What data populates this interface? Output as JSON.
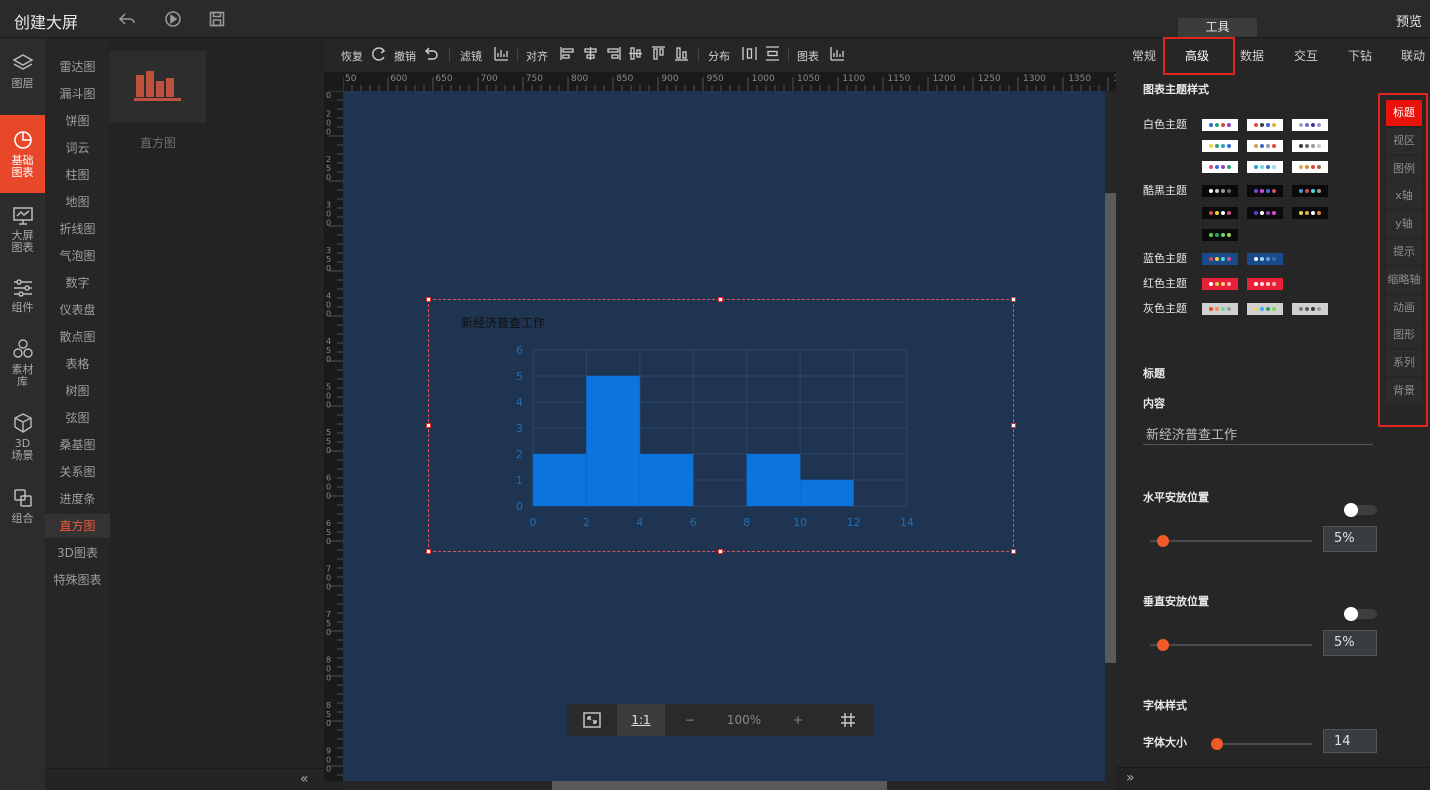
{
  "app": {
    "title": "创建大屏",
    "preview": "预览"
  },
  "tool_tab": "工具",
  "leftnav": [
    {
      "label": "图层",
      "icon": "layers-icon"
    },
    {
      "label": "基础图表",
      "icon": "pie-chart-icon",
      "active": true
    },
    {
      "label": "大屏图表",
      "icon": "monitor-chart-icon"
    },
    {
      "label": "组件",
      "icon": "sliders-icon"
    },
    {
      "label": "素材库",
      "icon": "hexagons-icon"
    },
    {
      "label": "3D场景",
      "icon": "cube-icon"
    },
    {
      "label": "组合",
      "icon": "combine-icon"
    }
  ],
  "chart_types": [
    "雷达图",
    "漏斗图",
    "饼图",
    "词云",
    "柱图",
    "地图",
    "折线图",
    "气泡图",
    "数字",
    "仪表盘",
    "散点图",
    "表格",
    "树图",
    "弦图",
    "桑基图",
    "关系图",
    "进度条",
    "直方图",
    "3D图表",
    "特殊图表"
  ],
  "chart_types_active": "直方图",
  "thumbnail": {
    "label": "直方图",
    "icon": "histogram-icon",
    "color": "#c1513f"
  },
  "toolbar": {
    "redo": "恢复",
    "undo": "撤销",
    "filter": "滤镜",
    "align": "对齐",
    "distribute": "分布",
    "chart": "图表"
  },
  "ruler": {
    "h_ticks": [
      "50",
      "600",
      "650",
      "700",
      "750",
      "800",
      "850",
      "900",
      "950",
      "1000",
      "1050",
      "1100",
      "1150",
      "1200",
      "1250",
      "1300",
      "1350",
      "140"
    ],
    "v_ticks": [
      "0",
      "200",
      "250",
      "300",
      "350",
      "400",
      "450",
      "500",
      "550",
      "600",
      "650",
      "700",
      "750",
      "800",
      "850",
      "900"
    ]
  },
  "chart_data": {
    "type": "bar",
    "subtype": "histogram",
    "title": "新经济普查工作",
    "bins": [
      {
        "x0": 0,
        "x1": 2,
        "value": 2
      },
      {
        "x0": 2,
        "x1": 4,
        "value": 5
      },
      {
        "x0": 4,
        "x1": 6,
        "value": 2
      },
      {
        "x0": 6,
        "x1": 8,
        "value": 0
      },
      {
        "x0": 8,
        "x1": 10,
        "value": 2
      },
      {
        "x0": 10,
        "x1": 12,
        "value": 1
      },
      {
        "x0": 12,
        "x1": 14,
        "value": 0
      }
    ],
    "xlim": [
      0,
      14
    ],
    "ylim": [
      0,
      6
    ],
    "x_ticks": [
      0,
      2,
      4,
      6,
      8,
      10,
      12,
      14
    ],
    "y_ticks": [
      0,
      1,
      2,
      3,
      4,
      5,
      6
    ],
    "grid": true,
    "bar_color": "#0b74de",
    "axis_label_color": "#1f6fb8"
  },
  "zoom": {
    "fit": "fit-screen-icon",
    "ratio": "1:1",
    "minus": "−",
    "level": "100%",
    "plus": "+",
    "grid": "grid-icon"
  },
  "right_tabs": [
    "常规",
    "高级",
    "数据",
    "交互",
    "下钻",
    "联动"
  ],
  "right_tab_active": "高级",
  "theme_section": {
    "title": "图表主题样式",
    "groups": [
      {
        "label": "白色主题",
        "bg": "#ffffff",
        "swatches": [
          [
            "#2f6bd8",
            "#2aa36a",
            "#d94a3c",
            "#8f45c7"
          ],
          [
            "#d94a3c",
            "#3a3a3a",
            "#2f6bd8",
            "#d9b14a"
          ],
          [
            "#9aa8c8",
            "#6a6ad8",
            "#3a3a9a",
            "#9a9ac8"
          ],
          [
            "#e6d74a",
            "#2aa36a",
            "#2f9bd8",
            "#2f6bd8"
          ],
          [
            "#d99a4a",
            "#3a6ab8",
            "#9a9a9a",
            "#d94a3c"
          ],
          [
            "#3a3a3a",
            "#6a6a6a",
            "#9a9a9a",
            "#c8c8c8"
          ],
          [
            "#d94a8a",
            "#2f6bd8",
            "#8f45c7",
            "#2aa36a"
          ],
          [
            "#2f9bd8",
            "#6ad8d8",
            "#2f6bd8",
            "#9ad8e8"
          ],
          [
            "#d9b14a",
            "#d98a3a",
            "#d94a3c",
            "#9a6a3a"
          ]
        ]
      },
      {
        "label": "酷黑主题",
        "bg": "#0a0a0a",
        "swatches": [
          [
            "#ffffff",
            "#cccccc",
            "#999999",
            "#666666"
          ],
          [
            "#6a4ad8",
            "#d94ad8",
            "#4a6ad8",
            "#d94a6a"
          ],
          [
            "#4a9ad8",
            "#d94a4a",
            "#4ad8d8",
            "#9a9a9a"
          ],
          [
            "#d94a3c",
            "#e6d74a",
            "#ffffff",
            "#d94a8a"
          ],
          [
            "#4a4ad8",
            "#ffffff",
            "#8f45c7",
            "#d94ad8"
          ],
          [
            "#e6d74a",
            "#d9b14a",
            "#ffffff",
            "#d98a3a"
          ],
          [
            "#4ad84a",
            "#2aa36a",
            "#6ad86a",
            "#9ad84a"
          ]
        ]
      },
      {
        "label": "蓝色主题",
        "bg": "#1b4a8a",
        "swatches": [
          [
            "#d94a3c",
            "#e6d74a",
            "#4ad8d8",
            "#d94a8a"
          ],
          [
            "#ffffff",
            "#9ad8e8",
            "#6a9ad8",
            "#3a6ab8"
          ]
        ]
      },
      {
        "label": "红色主题",
        "bg": "#e8203a",
        "swatches": [
          [
            "#ffffff",
            "#e6d74a",
            "#ffcc88",
            "#ffb0b0"
          ],
          [
            "#ffffff",
            "#ffdede",
            "#ffcccc",
            "#ffaaaa"
          ]
        ]
      },
      {
        "label": "灰色主题",
        "bg": "#d0d0d0",
        "swatches": [
          [
            "#e8472a",
            "#f08a6a",
            "#6ad8a8",
            "#9a9a9a"
          ],
          [
            "#e6d74a",
            "#4aa3ff",
            "#2aa36a",
            "#7ad84a"
          ],
          [
            "#7a7a7a",
            "#5a5a5a",
            "#3a3a3a",
            "#9a9a9a"
          ]
        ]
      }
    ]
  },
  "vertical_tabs": [
    "标题",
    "视区",
    "图例",
    "x轴",
    "y轴",
    "提示",
    "缩略轴",
    "动画",
    "图形",
    "系列",
    "背景"
  ],
  "vertical_tab_active": "标题",
  "title_section": {
    "title": "标题",
    "content_label": "内容",
    "content_value": "新经济普查工作",
    "h_pos_label": "水平安放位置",
    "h_pos_value": "5%",
    "h_pos_fraction": 0.05,
    "v_pos_label": "垂直安放位置",
    "v_pos_value": "5%",
    "v_pos_fraction": 0.05,
    "font_section": "字体样式",
    "font_size_label": "字体大小",
    "font_size_value": "14"
  },
  "colors": {
    "accent": "#e8472a",
    "highlight": "#e0251c",
    "canvas": "#1e3450"
  }
}
